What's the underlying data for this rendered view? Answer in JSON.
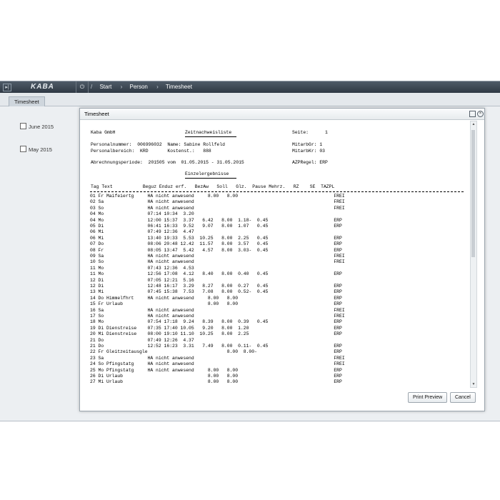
{
  "topbar": {
    "menu_glyph": "▸|",
    "logo": "KABA",
    "power_glyph": "⏻",
    "crumbs": [
      "Start",
      "Person",
      "Timesheet"
    ]
  },
  "tab": {
    "label": "Timesheet"
  },
  "sidebar": {
    "items": [
      {
        "label": "June 2015"
      },
      {
        "label": "May 2015"
      }
    ]
  },
  "dialog": {
    "title": "Timesheet",
    "header": {
      "company": "Kaba GmbH",
      "doc_title": "Zeitnachweisliste",
      "seite_label": "Seite:",
      "seite_value": "1",
      "line2": "Personalnummer:  006996032  Name: Sabine Rollfeld",
      "line2_right": "MitarbGr: 1",
      "line3": "Personalbereich:  KRD       Kostenst.:   888",
      "line3_right": "MitarbKr: 03",
      "line4": "Abrechnungsperiode:  201505 vom  01.05.2015 - 31.05.2015",
      "line4_right": "AZPRegel: ERP",
      "section": "Einzelergebnisse",
      "columns": "Tag Text           Beguz Enduz erf.   BezAw   Soll   Glz.  Pause Mehrz.   RZ    SE  TAZPL"
    },
    "rows": [
      "01 Fr Maifeiertg     HA nicht anwesend     8.00   8.00                                   FREI",
      "02 Sa                HA nicht anwesend                                                   FREI",
      "03 So                HA nicht anwesend                                                   FREI",
      "04 Mo                07:14 10:34  3.20",
      "04 Mo                12:00 15:37  3.37   6.42   8.00  1.18-  0.45                        ERP",
      "05 Di                06:41 16:33  9.52   9.07   8.00  1.07   0.45                        ERP",
      "06 Mi                07:49 12:36  4.47",
      "06 Mi                13:40 19:33  5.53  10.25   8.00  2.25   0.45                        ERP",
      "07 Do                08:06 20:48 12.42  11.57   8.00  3.57   0.45                        ERP",
      "08 Fr                08:05 13:47  5.42   4.57   8.00  3.03-  0.45                        ERP",
      "09 Sa                HA nicht anwesend                                                   FREI",
      "10 So                HA nicht anwesend                                                   FREI",
      "11 Mo                07:43 12:36  4.53",
      "11 Mo                12:56 17:08  4.12   8.40   8.00  0.40   0.45                        ERP",
      "12 Di                07:05 12:21  5.16",
      "12 Di                12:48 16:17  3.29   8.27   8.00  0.27   0.45                        ERP",
      "13 Mi                07:45 15:38  7.53   7.08   8.00  0.52-  0.45                        ERP",
      "14 Do Himmelfhrt     HA nicht anwesend     8.00   8.00                                   ERP",
      "15 Fr Urlaub                               8.00   8.00                                   ERP",
      "16 Sa                HA nicht anwesend                                                   FREI",
      "17 So                HA nicht anwesend                                                   FREI",
      "18 Mo                07:54 17:18  9.24   8.39   8.00  0.39   0.45                        ERP",
      "19 Di Dienstreise    07:35 17:40 10.05   9.20   8.00  1.20                               ERP",
      "20 Mi Dienstreise    08:00 19:10 11.10  10.25   8.00  2.25                               ERP",
      "21 Do                07:49 12:26  4.37",
      "21 Do                12:52 16:23  3.31   7.49   8.00  0.11-  0.45                        ERP",
      "22 Fr Gleitzeitausgle                             8.00  8.00-                            ERP",
      "23 Sa                HA nicht anwesend                                                   FREI",
      "24 So Pfingstatg     HA nicht anwesend                                                   FREI",
      "25 Mo Pfingstatg     HA nicht anwesend     8.00   8.00                                   ERP",
      "26 Di Urlaub                               8.00   8.00                                   ERP",
      "27 Mi Urlaub                               8.00   8.00                                   ERP"
    ],
    "print_label": "Print Preview",
    "cancel_label": "Cancel"
  }
}
